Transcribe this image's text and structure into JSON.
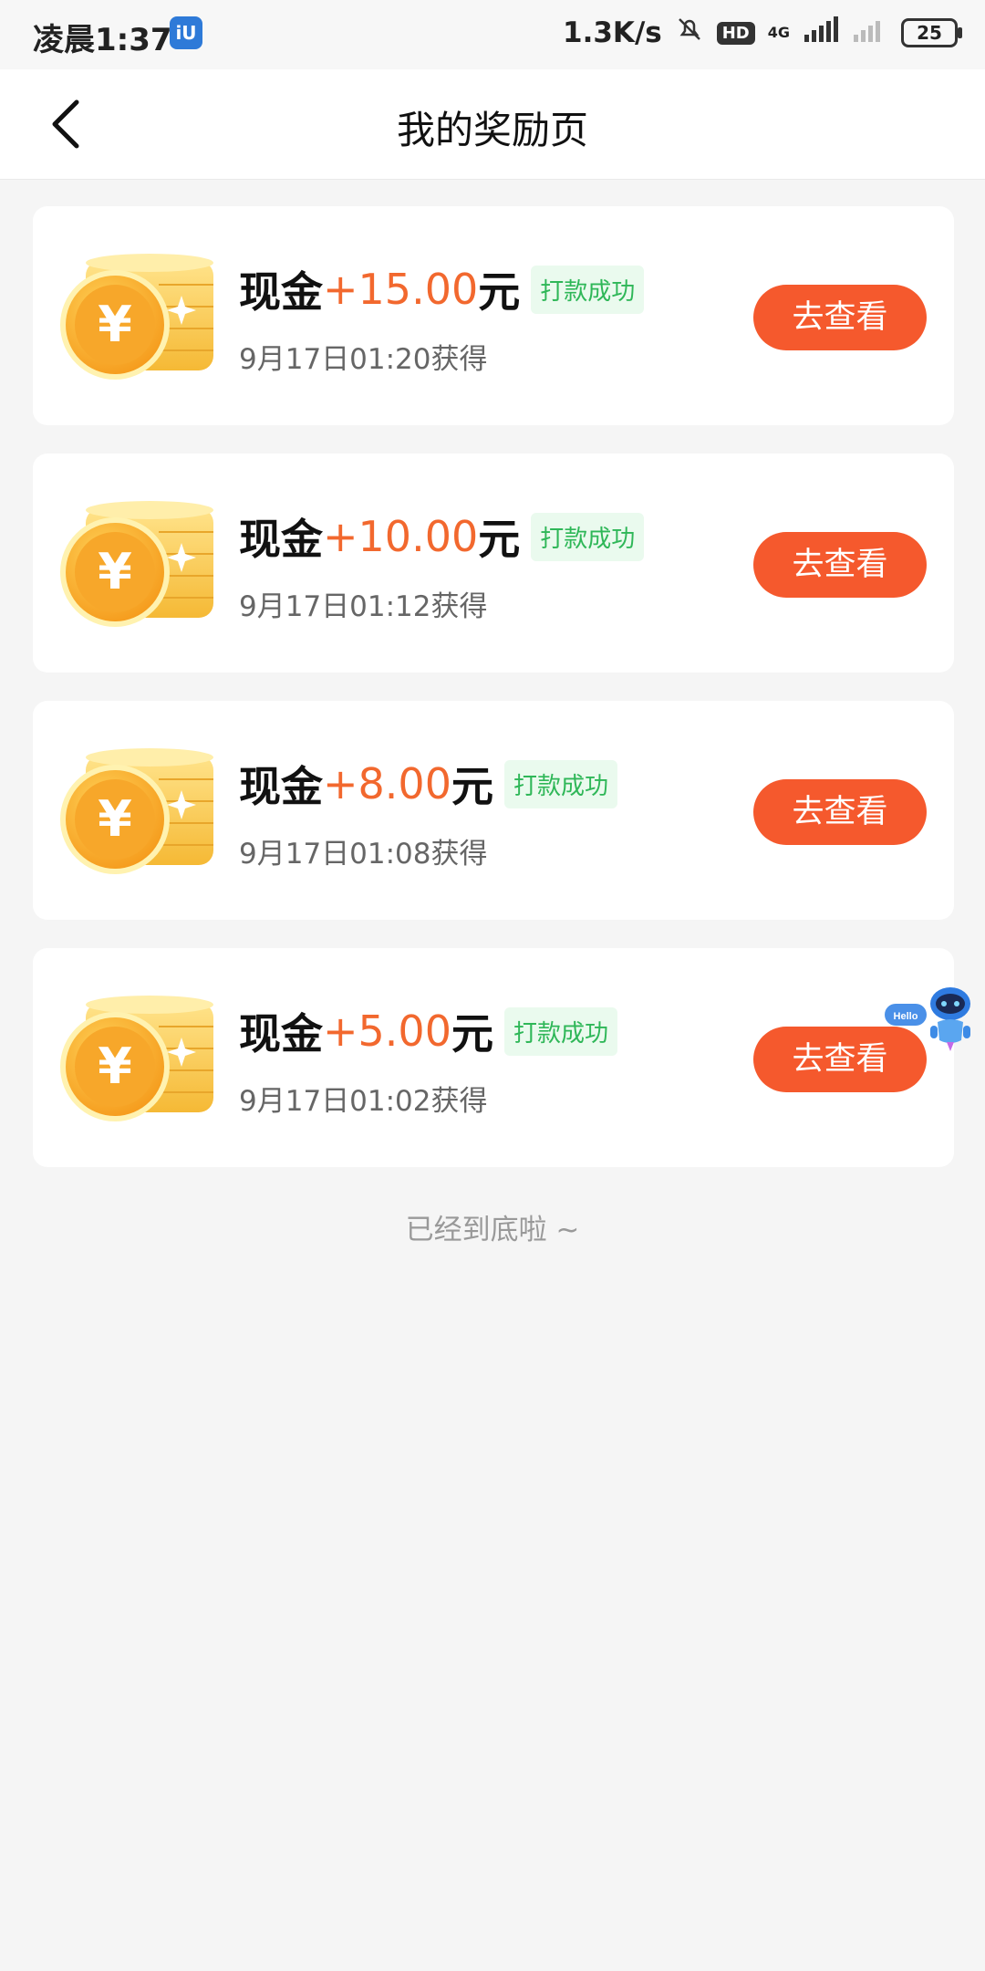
{
  "status_bar": {
    "time": "凌晨1:37",
    "app_icon_text": "iU",
    "net_speed": "1.3K/s",
    "hd": "HD",
    "signal": "4G",
    "battery": "25"
  },
  "header": {
    "title": "我的奖励页"
  },
  "rewards": [
    {
      "label": "现金",
      "amount": "+15.00",
      "unit": "元",
      "status": "打款成功",
      "time": "9月17日01:20获得",
      "button": "去查看"
    },
    {
      "label": "现金",
      "amount": "+10.00",
      "unit": "元",
      "status": "打款成功",
      "time": "9月17日01:12获得",
      "button": "去查看"
    },
    {
      "label": "现金",
      "amount": "+8.00",
      "unit": "元",
      "status": "打款成功",
      "time": "9月17日01:08获得",
      "button": "去查看"
    },
    {
      "label": "现金",
      "amount": "+5.00",
      "unit": "元",
      "status": "打款成功",
      "time": "9月17日01:02获得",
      "button": "去查看"
    }
  ],
  "footer_text": "已经到底啦 ~",
  "floating_assistant": {
    "bubble": "Hello"
  },
  "colors": {
    "accent": "#f5592d",
    "amount": "#f2682e",
    "success": "#2fb758",
    "success_bg": "#eafaee"
  }
}
